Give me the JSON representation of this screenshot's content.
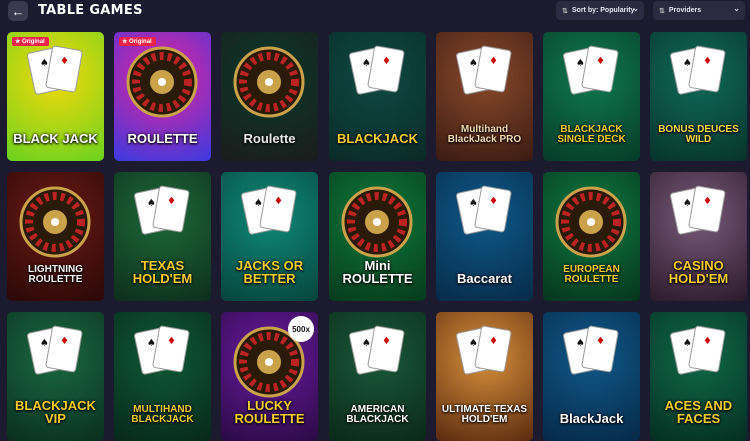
{
  "header": {
    "back_icon": "arrow-left-icon",
    "title": "TABLE GAMES",
    "sort_label": "Sort by: Popularity",
    "providers_label": "Providers"
  },
  "games": [
    {
      "label": "BLACK JACK",
      "badge": "Original",
      "bg": "#f5d90a",
      "bg2": "#6ad21f",
      "color": "#ffffff"
    },
    {
      "label": "ROULETTE",
      "badge": "Original",
      "bg": "#e7239b",
      "bg2": "#3a3ae0",
      "color": "#ffffff"
    },
    {
      "label": "Roulette",
      "badge": "",
      "bg": "#0b3b2a",
      "bg2": "#1b1b1b",
      "color": "#e8e8e8"
    },
    {
      "label": "BLACKJACK",
      "badge": "",
      "bg": "#0e4a42",
      "bg2": "#0a2a28",
      "color": "#f4cc2c"
    },
    {
      "label": "Multihand BlackJack PRO",
      "badge": "",
      "bg": "#8a4a2a",
      "bg2": "#3a1a12",
      "color": "#f2d9b0"
    },
    {
      "label": "BLACKJACK SINGLE DECK",
      "badge": "",
      "bg": "#0f7a52",
      "bg2": "#063a28",
      "color": "#f4cc2c"
    },
    {
      "label": "BONUS DEUCES WILD",
      "badge": "",
      "bg": "#0f6a58",
      "bg2": "#07332c",
      "color": "#ffd84a"
    },
    {
      "label": "LIGHTNING ROULETTE",
      "badge": "",
      "bg": "#6a1a12",
      "bg2": "#2a0808",
      "color": "#f4f4f4"
    },
    {
      "label": "TEXAS HOLD'EM",
      "badge": "",
      "bg": "#1e6a3a",
      "bg2": "#0c2e1a",
      "color": "#f4cc2c"
    },
    {
      "label": "JACKS OR BETTER",
      "badge": "",
      "bg": "#0f8a7a",
      "bg2": "#06443c",
      "color": "#f4cc2c"
    },
    {
      "label": "Mini ROULETTE",
      "badge": "",
      "bg": "#0f7a3a",
      "bg2": "#063a1c",
      "color": "#ffffff"
    },
    {
      "label": "Baccarat",
      "badge": "",
      "bg": "#0e5a8a",
      "bg2": "#062a48",
      "color": "#ffffff"
    },
    {
      "label": "EUROPEAN ROULETTE",
      "badge": "",
      "bg": "#0f7a40",
      "bg2": "#05351c",
      "color": "#f4cc2c"
    },
    {
      "label": "CASINO HOLD'EM",
      "badge": "",
      "bg": "#7a5a7a",
      "bg2": "#2a1a2a",
      "color": "#f4cc2c"
    },
    {
      "label": "BLACKJACK VIP",
      "badge": "",
      "bg": "#1a6a42",
      "bg2": "#0a2e1e",
      "color": "#f4cc2c"
    },
    {
      "label": "MULTIHAND BLACKJACK",
      "badge": "",
      "bg": "#0f5a36",
      "bg2": "#06281a",
      "color": "#f4cc2c"
    },
    {
      "label": "LUCKY ROULETTE",
      "badge": "",
      "bg": "#6a1aa0",
      "bg2": "#2a0a44",
      "color": "#f4cc2c",
      "extra": "500x"
    },
    {
      "label": "AMERICAN BLACKJACK",
      "badge": "",
      "bg": "#1a5a3a",
      "bg2": "#0a2818",
      "color": "#ffffff"
    },
    {
      "label": "ULTIMATE TEXAS HOLD'EM",
      "badge": "",
      "bg": "#d8903a",
      "bg2": "#5a2a10",
      "color": "#ffffff"
    },
    {
      "label": "BlackJack",
      "badge": "",
      "bg": "#0f5a8a",
      "bg2": "#062848",
      "color": "#ffffff"
    },
    {
      "label": "ACES AND FACES",
      "badge": "",
      "bg": "#0f6a4a",
      "bg2": "#052e20",
      "color": "#f4cc2c"
    }
  ]
}
